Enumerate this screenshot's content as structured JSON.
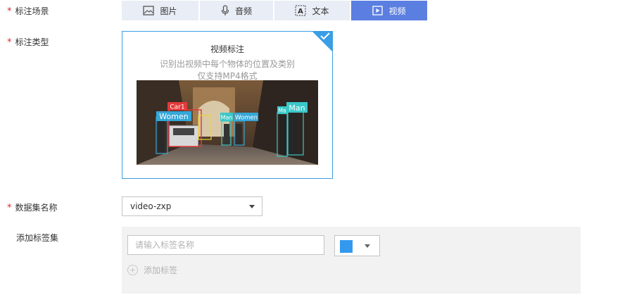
{
  "form": {
    "scene_label": "标注场景",
    "type_label": "标注类型",
    "dataset_label": "数据集名称",
    "labelset_label": "添加标签集",
    "required_mark": "*"
  },
  "scene_tabs": [
    {
      "label": "图片",
      "icon": "image-icon",
      "active": false
    },
    {
      "label": "音频",
      "icon": "microphone-icon",
      "active": false
    },
    {
      "label": "文本",
      "icon": "text-icon",
      "active": false
    },
    {
      "label": "视频",
      "icon": "play-icon",
      "active": true
    }
  ],
  "type_card": {
    "title": "视频标注",
    "desc1": "识别出视频中每个物体的位置及类别",
    "desc2": "仅支持MP4格式",
    "selected": true,
    "detections": [
      "Car1",
      "Women",
      "Man",
      "Women",
      "Ma",
      "Man"
    ]
  },
  "dataset": {
    "value": "video-zxp"
  },
  "labelset": {
    "placeholder": "请输入标签名称",
    "color": "#3399ee",
    "add_label": "添加标签"
  },
  "colors": {
    "accent": "#5b7fe0",
    "card_border": "#3a9ee6",
    "required": "#e0262b"
  }
}
